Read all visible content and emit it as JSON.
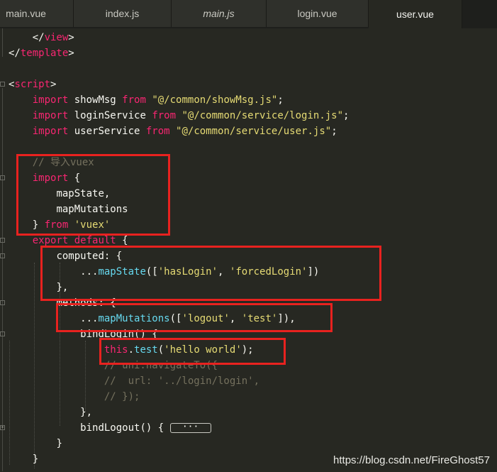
{
  "tabs": [
    {
      "label": "main.vue",
      "italic": false,
      "active": false
    },
    {
      "label": "index.js",
      "italic": false,
      "active": false
    },
    {
      "label": "main.js",
      "italic": true,
      "active": false
    },
    {
      "label": "login.vue",
      "italic": false,
      "active": false
    },
    {
      "label": "user.vue",
      "italic": false,
      "active": true
    }
  ],
  "code": {
    "l1_close_view_a": "</",
    "l1_view": "view",
    "l1_close": ">",
    "l2_close_tpl_a": "</",
    "l2_template": "template",
    "l2_close": ">",
    "l4_open": "<",
    "l4_script": "script",
    "l4_close": ">",
    "kw_import": "import",
    "l5_name": " showMsg ",
    "kw_from": "from",
    "l5_path": "\"@/common/showMsg.js\"",
    "semi": ";",
    "l6_name": " loginService ",
    "l6_path": "\"@/common/service/login.js\"",
    "l7_name": " userService ",
    "l7_path": "\"@/common/service/user.js\"",
    "l9_comment": "// 导入vuex",
    "l10_brace": " {",
    "l11_text": "mapState,",
    "l12_text": "mapMutations",
    "l13_brace": "} ",
    "l13_vuex": "'vuex'",
    "kw_export": "export",
    "kw_default": "default",
    "l14_brace": " {",
    "l15_computed": "computed: {",
    "l16_spread": "...",
    "l16_fn": "mapState",
    "l16_open": "([",
    "l16_s1": "'hasLogin'",
    "comma": ", ",
    "l16_s2": "'forcedLogin'",
    "l16_close": "])",
    "l17_text": "},",
    "l18_text": "methods: {",
    "l19_fn": "mapMutations",
    "l19_s1": "'logout'",
    "l19_s2": "'test'",
    "l19_close": "]),",
    "l20_text": "bindLogin() {",
    "l21_this": "this",
    "l21_dot": ".",
    "l21_fn": "test",
    "l21_open": "(",
    "l21_str": "'hello world'",
    "l21_close": ");",
    "l22_comment": "// uni.navigateTo({",
    "l23_comment": "//  url: '../login/login',",
    "l24_comment": "// });",
    "l25_text": "},",
    "l26_text": "bindLogout() { ",
    "l26_collapsed": "···",
    "l27_text": "}",
    "l28_text": "}"
  },
  "watermark": "https://blog.csdn.net/FireGhost57",
  "colors": {
    "background": "#272822",
    "keyword": "#f92672",
    "string": "#e6db74",
    "comment": "#75715e",
    "function": "#66d9ef",
    "highlight_box": "#e8221f"
  }
}
